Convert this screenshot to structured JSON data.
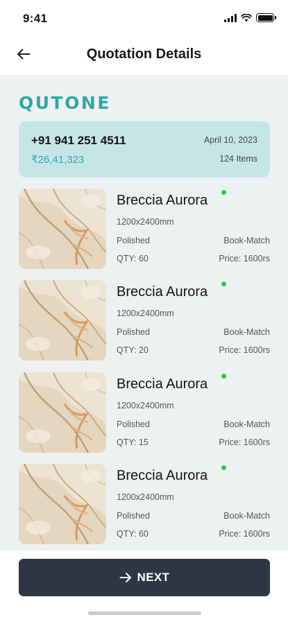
{
  "status_bar": {
    "time": "9:41"
  },
  "header": {
    "title": "Quotation Details",
    "back_icon": "arrow-left-icon"
  },
  "brand": {
    "logo_text": "QUTONE",
    "color": "#2ea8a5"
  },
  "summary": {
    "phone": "+91 941 251 4511",
    "amount": "₹26,41,323",
    "date": "April 10, 2023",
    "items": "124 Items"
  },
  "products": [
    {
      "name": "Breccia Aurora",
      "size": "1200x2400mm",
      "finish": "Polished",
      "match": "Book-Match",
      "qty": "QTY: 60",
      "price": "Price: 1600rs"
    },
    {
      "name": "Breccia Aurora",
      "size": "1200x2400mm",
      "finish": "Polished",
      "match": "Book-Match",
      "qty": "QTY: 20",
      "price": "Price: 1600rs"
    },
    {
      "name": "Breccia Aurora",
      "size": "1200x2400mm",
      "finish": "Polished",
      "match": "Book-Match",
      "qty": "QTY: 15",
      "price": "Price: 1600rs"
    },
    {
      "name": "Breccia Aurora",
      "size": "1200x2400mm",
      "finish": "Polished",
      "match": "Book-Match",
      "qty": "QTY: 60",
      "price": "Price: 1600rs"
    }
  ],
  "footer": {
    "next_label": "NEXT",
    "next_icon": "arrow-right-icon",
    "button_color": "#2e3545"
  },
  "colors": {
    "accent": "#2ea8a5",
    "summary_bg": "#c4e7e6",
    "in_stock": "#16d43d",
    "content_bg": "#eef1f2"
  }
}
